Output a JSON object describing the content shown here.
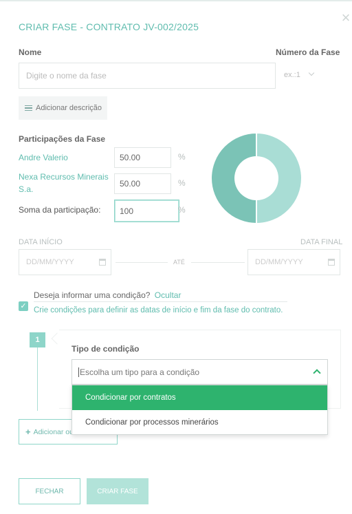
{
  "modal": {
    "title": "CRIAR FASE - CONTRATO JV-002/2025",
    "close_symbol": "×"
  },
  "form": {
    "name_label": "Nome",
    "name_placeholder": "Digite o nome da fase",
    "number_label": "Número da Fase",
    "number_placeholder": "ex.:1",
    "add_description": "Adicionar descrição"
  },
  "participations": {
    "heading": "Participações da Fase",
    "items": [
      {
        "name": "Andre Valerio",
        "value": "50.00",
        "share": 50
      },
      {
        "name": "Nexa Recursos Minerais S.a.",
        "value": "50.00",
        "share": 50
      }
    ],
    "sum_label": "Soma da participação:",
    "sum_value": "100",
    "percent_sign": "%"
  },
  "donut": {
    "colors": [
      "#a9ddd5",
      "#7bc3b6"
    ]
  },
  "dates": {
    "start_label": "DATA INÍCIO",
    "end_label": "DATA FINAL",
    "placeholder": "DD/MM/YYYY",
    "separator": "ATÉ"
  },
  "condition": {
    "question": "Deseja informar uma condição?",
    "toggle": "Ocultar",
    "hint": "Crie condições para definir as datas de início e fim da fase do contrato.",
    "checked": true,
    "step_number": "1",
    "type_label": "Tipo de condição",
    "select_placeholder": "Escolha um tipo para a condição",
    "options": [
      "Condicionar por contratos",
      "Condicionar por processos minerários"
    ],
    "selected_index": 0,
    "add_other": "Adicionar ou"
  },
  "footer": {
    "close": "FECHAR",
    "create": "CRIAR FASE"
  }
}
